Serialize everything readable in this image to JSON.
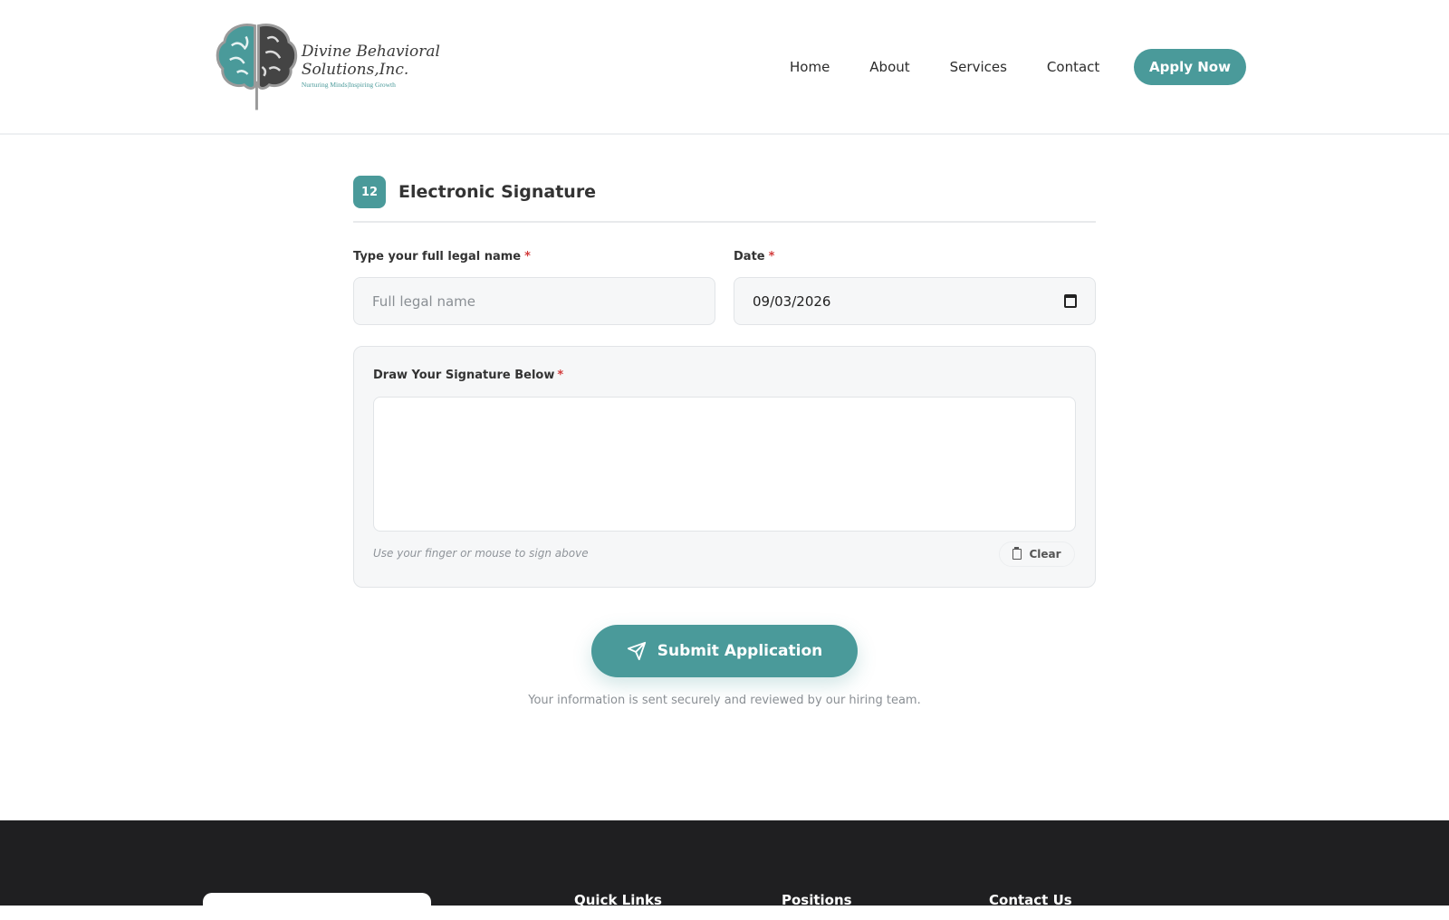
{
  "brand": {
    "name_line1": "Divine Behavioral",
    "name_line2": "Solutions,Inc.",
    "tagline": "Nurturing Minds|Inspiring Growth",
    "accent_color": "#4a9a9a"
  },
  "nav": {
    "items": [
      "Home",
      "About",
      "Services",
      "Contact"
    ],
    "cta": "Apply Now"
  },
  "section": {
    "number": "12",
    "title": "Electronic Signature"
  },
  "form": {
    "name_label": "Type your full legal name",
    "name_placeholder": "Full legal name",
    "date_label": "Date",
    "date_value": "09/03/2026",
    "required_mark": "*",
    "signature_label": "Draw Your Signature Below",
    "signature_hint": "Use your finger or mouse to sign above",
    "clear_label": "Clear",
    "submit_label": "Submit Application",
    "secure_note": "Your information is sent securely and reviewed by our hiring team."
  },
  "footer": {
    "columns": [
      "Quick Links",
      "Positions",
      "Contact Us"
    ]
  }
}
